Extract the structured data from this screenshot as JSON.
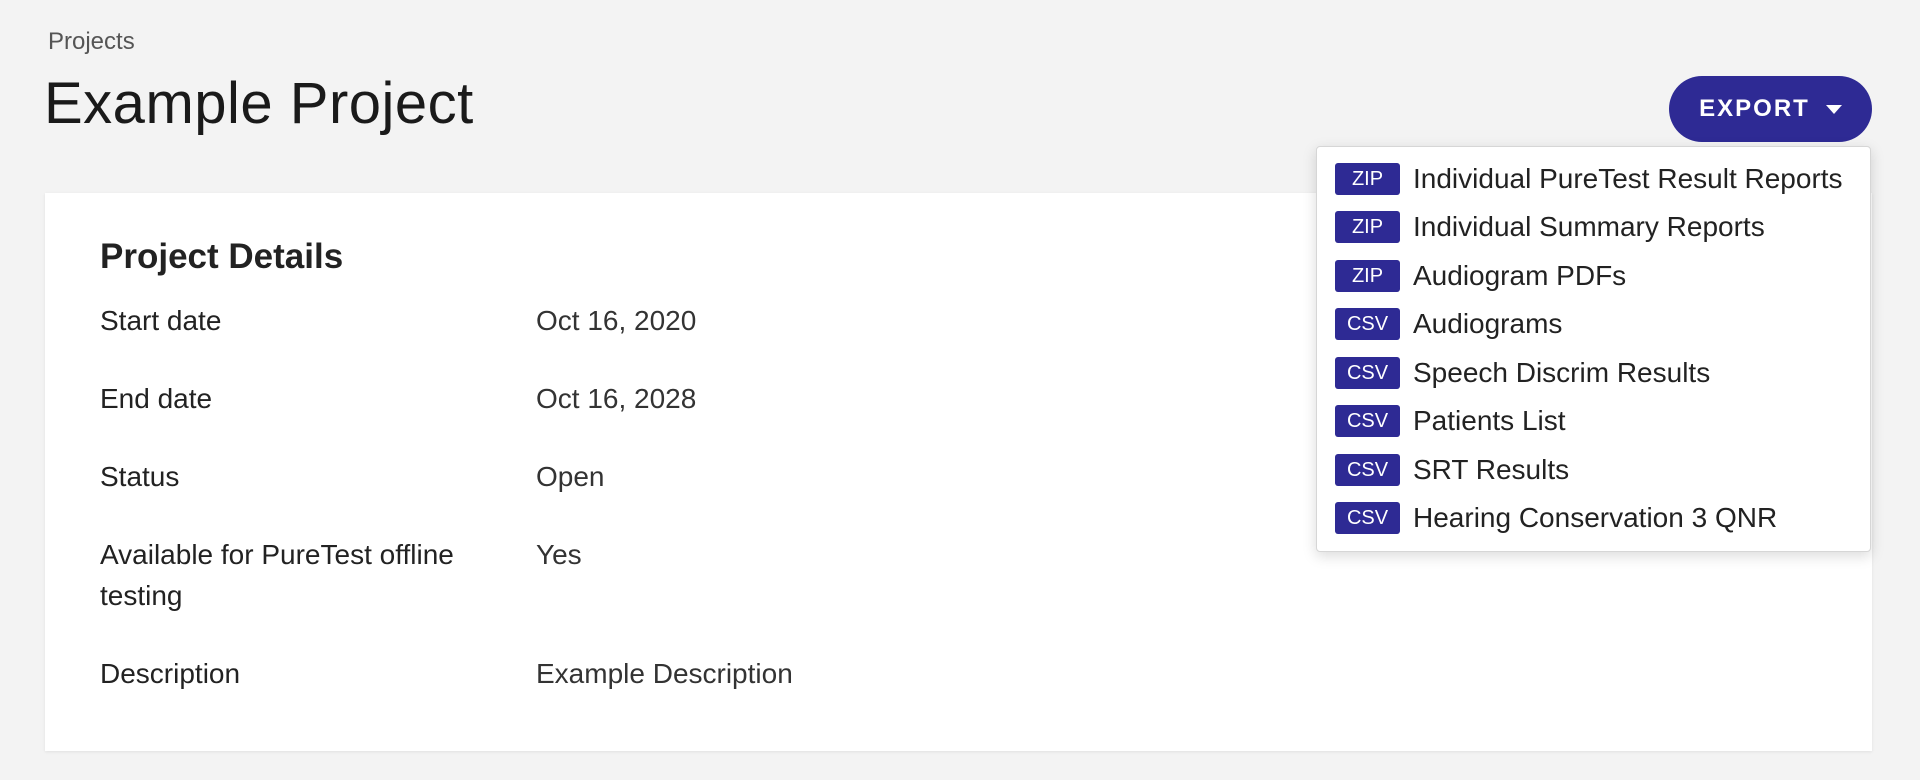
{
  "breadcrumb": "Projects",
  "page_title": "Example Project",
  "export_button": {
    "label": "EXPORT",
    "icon": "caret-down-icon"
  },
  "card": {
    "title": "Project Details",
    "rows": [
      {
        "label": "Start date",
        "value": "Oct 16, 2020"
      },
      {
        "label": "End date",
        "value": "Oct 16, 2028"
      },
      {
        "label": "Status",
        "value": "Open"
      },
      {
        "label": "Available for PureTest offline testing",
        "value": "Yes"
      },
      {
        "label": "Description",
        "value": "Example Description"
      }
    ]
  },
  "export_menu": {
    "items": [
      {
        "badge": "ZIP",
        "label": "Individual PureTest Result Reports"
      },
      {
        "badge": "ZIP",
        "label": "Individual Summary Reports"
      },
      {
        "badge": "ZIP",
        "label": "Audiogram PDFs"
      },
      {
        "badge": "CSV",
        "label": "Audiograms"
      },
      {
        "badge": "CSV",
        "label": "Speech Discrim Results"
      },
      {
        "badge": "CSV",
        "label": "Patients List"
      },
      {
        "badge": "CSV",
        "label": "SRT Results"
      },
      {
        "badge": "CSV",
        "label": "Hearing Conservation 3 QNR"
      }
    ]
  },
  "colors": {
    "accent": "#2e2a94",
    "background": "#f3f3f3",
    "card": "#ffffff"
  }
}
